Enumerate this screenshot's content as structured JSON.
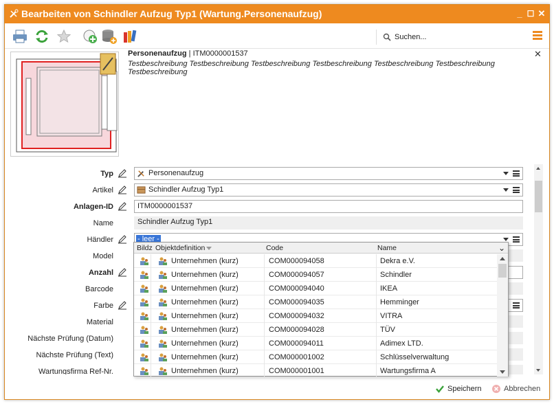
{
  "window": {
    "title": "Bearbeiten von Schindler Aufzug Typ1 (Wartung.Personenaufzug)",
    "minimize": "_",
    "maximize": "☐",
    "close": "✕"
  },
  "toolbar": {
    "search_placeholder": "Suchen..."
  },
  "header": {
    "type_name": "Personenaufzug",
    "separator": "|",
    "id": "ITM0000001537",
    "description": "Testbeschreibung Testbeschreibung Testbeschreibung Testbeschreibung Testbeschreibung Testbeschreibung Testbeschreibung",
    "close": "✕"
  },
  "form": {
    "typ_label": "Typ",
    "typ_value": "Personenaufzug",
    "artikel_label": "Artikel",
    "artikel_value": "Schindler Aufzug Typ1",
    "anlagen_label": "Anlagen-ID",
    "anlagen_value": "ITM0000001537",
    "name_label": "Name",
    "name_value": "Schindler Aufzug Typ1",
    "haendler_label": "Händler",
    "haendler_value": "- leer -",
    "model_label": "Model",
    "anzahl_label": "Anzahl",
    "barcode_label": "Barcode",
    "farbe_label": "Farbe",
    "material_label": "Material",
    "pruefung_datum_label": "Nächste Prüfung (Datum)",
    "pruefung_text_label": "Nächste Prüfung (Text)",
    "wartungsfirma_label": "Wartungsfirma Ref-Nr."
  },
  "dropdown": {
    "columns": [
      "Bildz",
      "Objektdefinition",
      "Code",
      "Name"
    ],
    "rows": [
      {
        "objekt": "Unternehmen (kurz)",
        "code": "COM000094058",
        "name": "Dekra e.V."
      },
      {
        "objekt": "Unternehmen (kurz)",
        "code": "COM000094057",
        "name": "Schindler"
      },
      {
        "objekt": "Unternehmen (kurz)",
        "code": "COM000094040",
        "name": "IKEA"
      },
      {
        "objekt": "Unternehmen (kurz)",
        "code": "COM000094035",
        "name": "Hemminger"
      },
      {
        "objekt": "Unternehmen (kurz)",
        "code": "COM000094032",
        "name": "VITRA"
      },
      {
        "objekt": "Unternehmen (kurz)",
        "code": "COM000094028",
        "name": "TÜV"
      },
      {
        "objekt": "Unternehmen (kurz)",
        "code": "COM000094011",
        "name": "Adimex LTD."
      },
      {
        "objekt": "Unternehmen (kurz)",
        "code": "COM000001002",
        "name": "Schlüsselverwaltung"
      },
      {
        "objekt": "Unternehmen (kurz)",
        "code": "COM000001001",
        "name": "Wartungsfirma A"
      }
    ]
  },
  "footer": {
    "save": "Speichern",
    "cancel": "Abbrechen"
  },
  "colors": {
    "accent": "#ee8a1f",
    "selection": "#3875d7"
  }
}
